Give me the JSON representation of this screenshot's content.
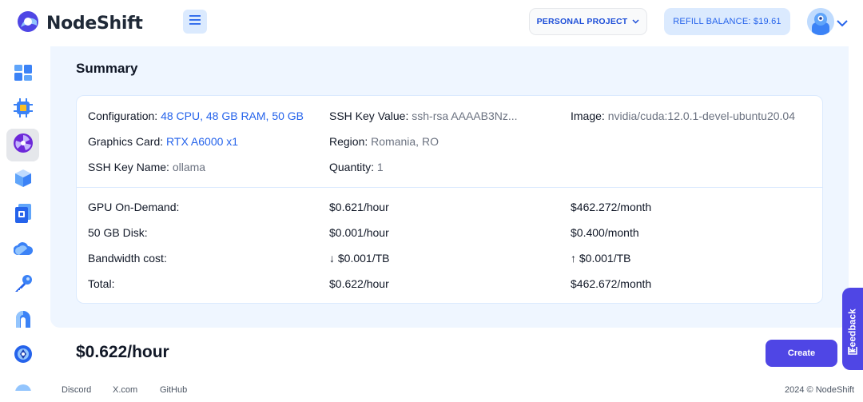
{
  "brand": {
    "name": "NodeShift"
  },
  "header": {
    "project_label": "PERSONAL PROJECT",
    "refill_label": "REFILL BALANCE: $19.61"
  },
  "sidebar": {
    "items": [
      {
        "icon": "dashboard-icon"
      },
      {
        "icon": "cpu-chip-icon"
      },
      {
        "icon": "gpu-fan-icon",
        "active": true
      },
      {
        "icon": "cube-icon"
      },
      {
        "icon": "storage-icon"
      },
      {
        "icon": "cloud-icon"
      },
      {
        "icon": "key-icon"
      },
      {
        "icon": "deploy-icon"
      },
      {
        "icon": "network-icon"
      }
    ]
  },
  "summary": {
    "title": "Summary",
    "config": {
      "configuration_label": "Configuration:",
      "configuration_value": "48 CPU, 48 GB RAM, 50 GB",
      "ssh_key_value_label": "SSH Key Value:",
      "ssh_key_value": "ssh-rsa AAAAB3Nz...",
      "image_label": "Image:",
      "image_value": "nvidia/cuda:12.0.1-devel-ubuntu20.04",
      "graphics_label": "Graphics Card:",
      "graphics_value": "RTX A6000 x1",
      "region_label": "Region:",
      "region_value": "Romania, RO",
      "ssh_key_name_label": "SSH Key Name:",
      "ssh_key_name_value": "ollama",
      "quantity_label": "Quantity:",
      "quantity_value": "1"
    },
    "costs": [
      {
        "label": "GPU On-Demand:",
        "hourly": "$0.621/hour",
        "monthly": "$462.272/month"
      },
      {
        "label": "50 GB Disk:",
        "hourly": "$0.001/hour",
        "monthly": "$0.400/month"
      },
      {
        "label": "Bandwidth cost:",
        "hourly": "↓ $0.001/TB",
        "monthly": "↑ $0.001/TB"
      },
      {
        "label": "Total:",
        "hourly": "$0.622/hour",
        "monthly": "$462.672/month"
      }
    ]
  },
  "footer_bar": {
    "total_price": "$0.622/hour",
    "create_label": "Create",
    "feedback_label": "Feedback"
  },
  "footer": {
    "links": [
      "Discord",
      "X.com",
      "GitHub"
    ],
    "copyright": "2024 © NodeShift"
  },
  "colors": {
    "accent": "#2563eb",
    "primary_button": "#4f46e5",
    "panel_bg": "#eff6ff"
  }
}
